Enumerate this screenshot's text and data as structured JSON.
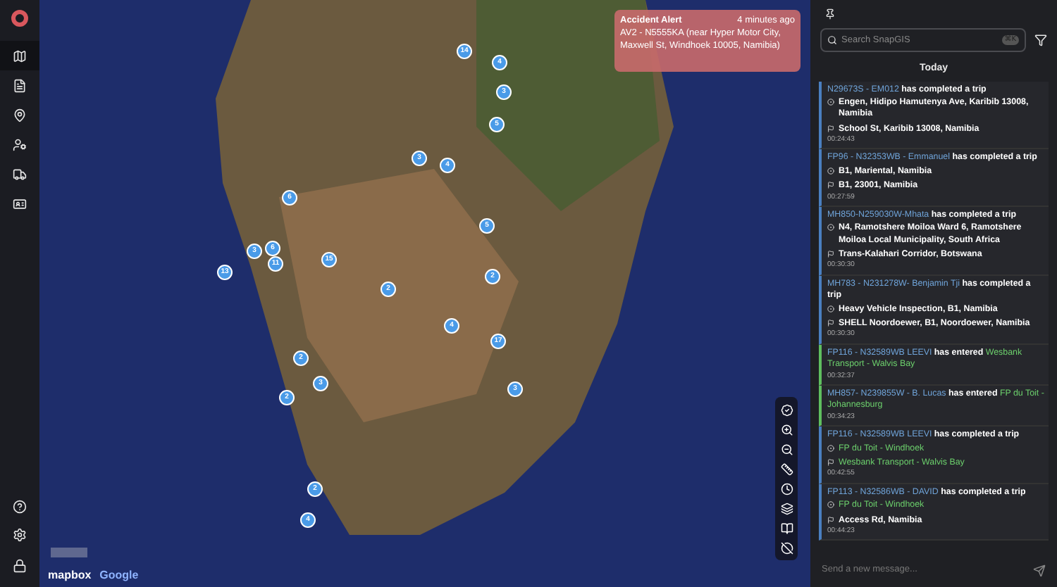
{
  "alert": {
    "title": "Accident Alert",
    "time": "4 minutes ago",
    "message": "AV2 - N5555KA (near Hyper Motor City, Maxwell St, Windhoek 10005, Namibia)"
  },
  "clusters": [
    "14",
    "4",
    "3",
    "5",
    "3",
    "4",
    "6",
    "5",
    "3",
    "6",
    "11",
    "15",
    "13",
    "2",
    "2",
    "4",
    "17",
    "2",
    "3",
    "2",
    "3",
    "2",
    "4"
  ],
  "attribution": {
    "mapbox": "mapbox",
    "google": "Google"
  },
  "search": {
    "placeholder": "Search SnapGIS",
    "shortcut": "⌘K"
  },
  "feed_heading": "Today",
  "events": [
    {
      "kind": "trip",
      "parts": [
        {
          "kind": "id",
          "text": "N29673S - EM012"
        },
        {
          "kind": "plain",
          "text": "has completed a trip"
        }
      ],
      "from": [
        {
          "kind": "plain",
          "text": "Engen, Hidipo Hamutenya Ave, Karibib 13008, Namibia"
        }
      ],
      "to": [
        {
          "kind": "plain",
          "text": "School St, Karibib 13008, Namibia"
        }
      ],
      "time": "00:24:43"
    },
    {
      "kind": "trip",
      "parts": [
        {
          "kind": "id",
          "text": "FP96 - N32353WB - Emmanuel"
        },
        {
          "kind": "plain",
          "text": "has completed a trip"
        }
      ],
      "from": [
        {
          "kind": "plain",
          "text": "B1, Mariental, Namibia"
        }
      ],
      "to": [
        {
          "kind": "plain",
          "text": "B1, 23001, Namibia"
        }
      ],
      "time": "00:27:59"
    },
    {
      "kind": "trip",
      "parts": [
        {
          "kind": "id",
          "text": "MH850-N259030W-Mhata"
        },
        {
          "kind": "plain",
          "text": "has completed a trip"
        }
      ],
      "from": [
        {
          "kind": "plain",
          "text": "N4, Ramotshere Moiloa Ward 6, Ramotshere Moiloa Local Municipality, South Africa"
        }
      ],
      "to": [
        {
          "kind": "plain",
          "text": "Trans-Kalahari Corridor, Botswana"
        }
      ],
      "time": "00:30:30"
    },
    {
      "kind": "trip",
      "parts": [
        {
          "kind": "id",
          "text": "MH783 -  N231278W- Benjamin Tji"
        },
        {
          "kind": "plain",
          "text": "has completed a trip"
        }
      ],
      "from": [
        {
          "kind": "plain",
          "text": "Heavy Vehicle Inspection, B1, Namibia"
        }
      ],
      "to": [
        {
          "kind": "plain",
          "text": "SHELL Noordoewer, B1, Noordoewer, Namibia"
        }
      ],
      "time": "00:30:30"
    },
    {
      "kind": "enter",
      "parts": [
        {
          "kind": "id",
          "text": "FP116 - N32589WB LEEVI"
        },
        {
          "kind": "plain",
          "text": "has entered"
        },
        {
          "kind": "place",
          "text": "Wesbank Transport - Walvis Bay"
        }
      ],
      "time": "00:32:37"
    },
    {
      "kind": "enter",
      "parts": [
        {
          "kind": "id",
          "text": "MH857- N239855W - B. Lucas"
        },
        {
          "kind": "plain",
          "text": "has entered"
        },
        {
          "kind": "place",
          "text": "FP du Toit - Johannesburg"
        }
      ],
      "time": "00:34:23"
    },
    {
      "kind": "trip",
      "parts": [
        {
          "kind": "id",
          "text": "FP116 - N32589WB LEEVI"
        },
        {
          "kind": "plain",
          "text": "has completed a trip"
        }
      ],
      "from": [
        {
          "kind": "place",
          "text": "FP du Toit - Windhoek"
        }
      ],
      "to": [
        {
          "kind": "place",
          "text": "Wesbank Transport - Walvis Bay"
        }
      ],
      "time": "00:42:55"
    },
    {
      "kind": "trip",
      "parts": [
        {
          "kind": "id",
          "text": "FP113 - N32586WB - DAVID"
        },
        {
          "kind": "plain",
          "text": "has completed a trip"
        }
      ],
      "from": [
        {
          "kind": "place",
          "text": "FP du Toit - Windhoek"
        }
      ],
      "to": [
        {
          "kind": "plain",
          "text": "Access Rd, Namibia"
        }
      ],
      "time": "00:44:23"
    }
  ],
  "message": {
    "placeholder": "Send a new message..."
  }
}
